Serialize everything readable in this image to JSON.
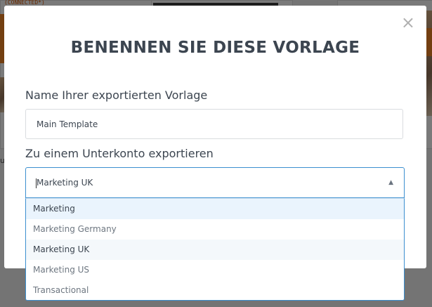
{
  "background": {
    "tag_text": "(CONNECTED*)",
    "side_text": "ub"
  },
  "modal": {
    "title": "BENENNEN SIE DIESE VORLAGE",
    "close_glyph": "×",
    "name_label": "Name Ihrer exportierten Vorlage",
    "name_value": "Main Template",
    "subaccount_label": "Zu einem Unterkonto exportieren",
    "subaccount_selected": "Marketing UK",
    "arrow_glyph": "▲",
    "options": [
      {
        "label": "Marketing"
      },
      {
        "label": "Marketing Germany"
      },
      {
        "label": "Marketing UK"
      },
      {
        "label": "Marketing US"
      },
      {
        "label": "Transactional"
      }
    ]
  }
}
